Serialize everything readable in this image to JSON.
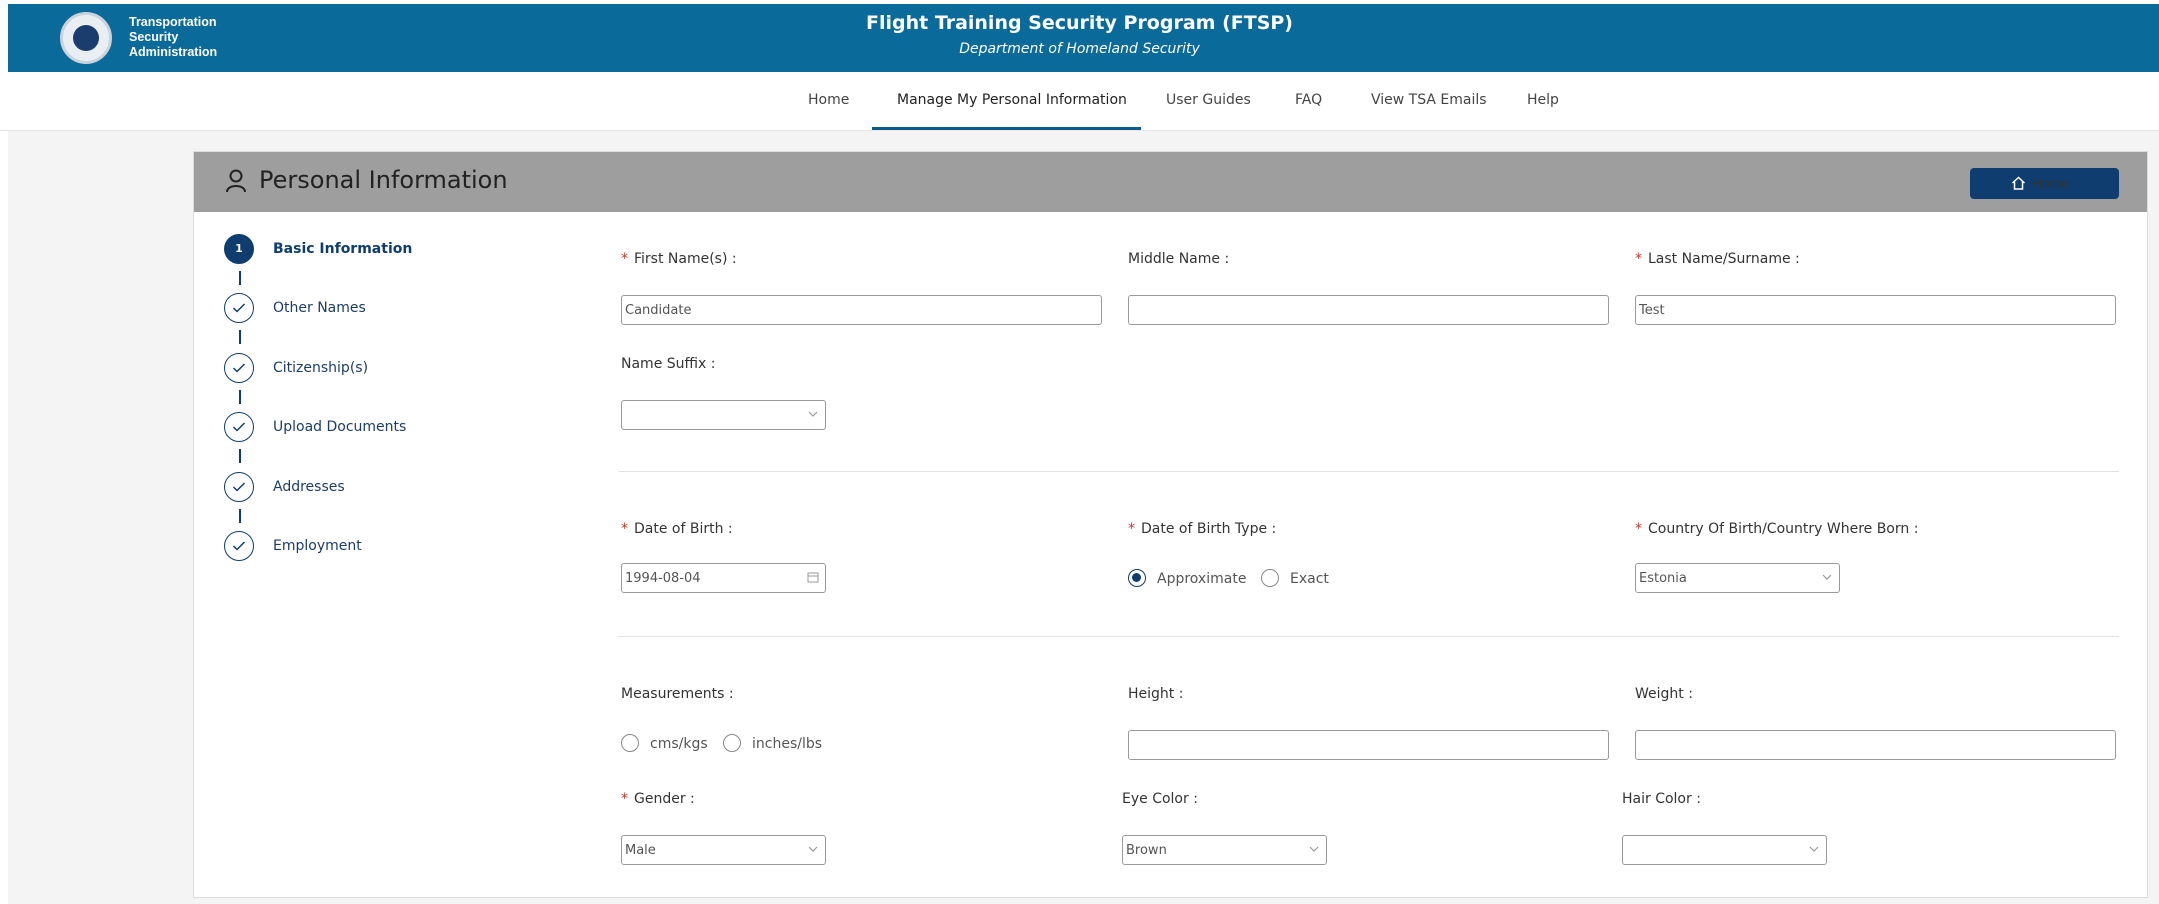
{
  "header": {
    "agency_lines": [
      "Transportation",
      "Security",
      "Administration"
    ],
    "title": "Flight Training Security Program (FTSP)",
    "subtitle": "Department of Homeland Security"
  },
  "nav": {
    "items": [
      "Home",
      "Manage My Personal Information",
      "User Guides",
      "FAQ",
      "View TSA Emails",
      "Help"
    ],
    "active": "Manage My Personal Information"
  },
  "card": {
    "title": "Personal Information",
    "home_button": "Home"
  },
  "steps": [
    {
      "number": "1",
      "label": "Basic Information",
      "state": "current"
    },
    {
      "label": "Other Names",
      "state": "complete"
    },
    {
      "label": "Citizenship(s)",
      "state": "complete"
    },
    {
      "label": "Upload Documents",
      "state": "complete"
    },
    {
      "label": "Addresses",
      "state": "complete"
    },
    {
      "label": "Employment",
      "state": "complete"
    }
  ],
  "form": {
    "required_mark": "*",
    "first_name": {
      "label": "First Name(s) :",
      "value": "Candidate"
    },
    "middle_name": {
      "label": "Middle Name :",
      "value": ""
    },
    "last_name": {
      "label": "Last Name/Surname :",
      "value": "Test"
    },
    "name_suffix": {
      "label": "Name Suffix :",
      "value": ""
    },
    "dob": {
      "label": "Date of Birth :",
      "value": "1994-08-04"
    },
    "dob_type": {
      "label": "Date of Birth Type :",
      "options": [
        "Approximate",
        "Exact"
      ],
      "selected": "Approximate"
    },
    "country_of_birth": {
      "label": "Country Of Birth/Country Where Born :",
      "value": "Estonia"
    },
    "measurements": {
      "label": "Measurements :",
      "options": [
        "cms/kgs",
        "inches/lbs"
      ],
      "selected": ""
    },
    "height": {
      "label": "Height :",
      "value": ""
    },
    "weight": {
      "label": "Weight :",
      "value": ""
    },
    "gender": {
      "label": "Gender :",
      "value": "Male"
    },
    "eye_color": {
      "label": "Eye Color :",
      "value": "Brown"
    },
    "hair_color": {
      "label": "Hair Color :",
      "value": ""
    }
  },
  "colors": {
    "header_blue": "#0a6a9a",
    "navy": "#0f3d70",
    "required": "#c0392b",
    "card_header": "#9e9e9e"
  }
}
